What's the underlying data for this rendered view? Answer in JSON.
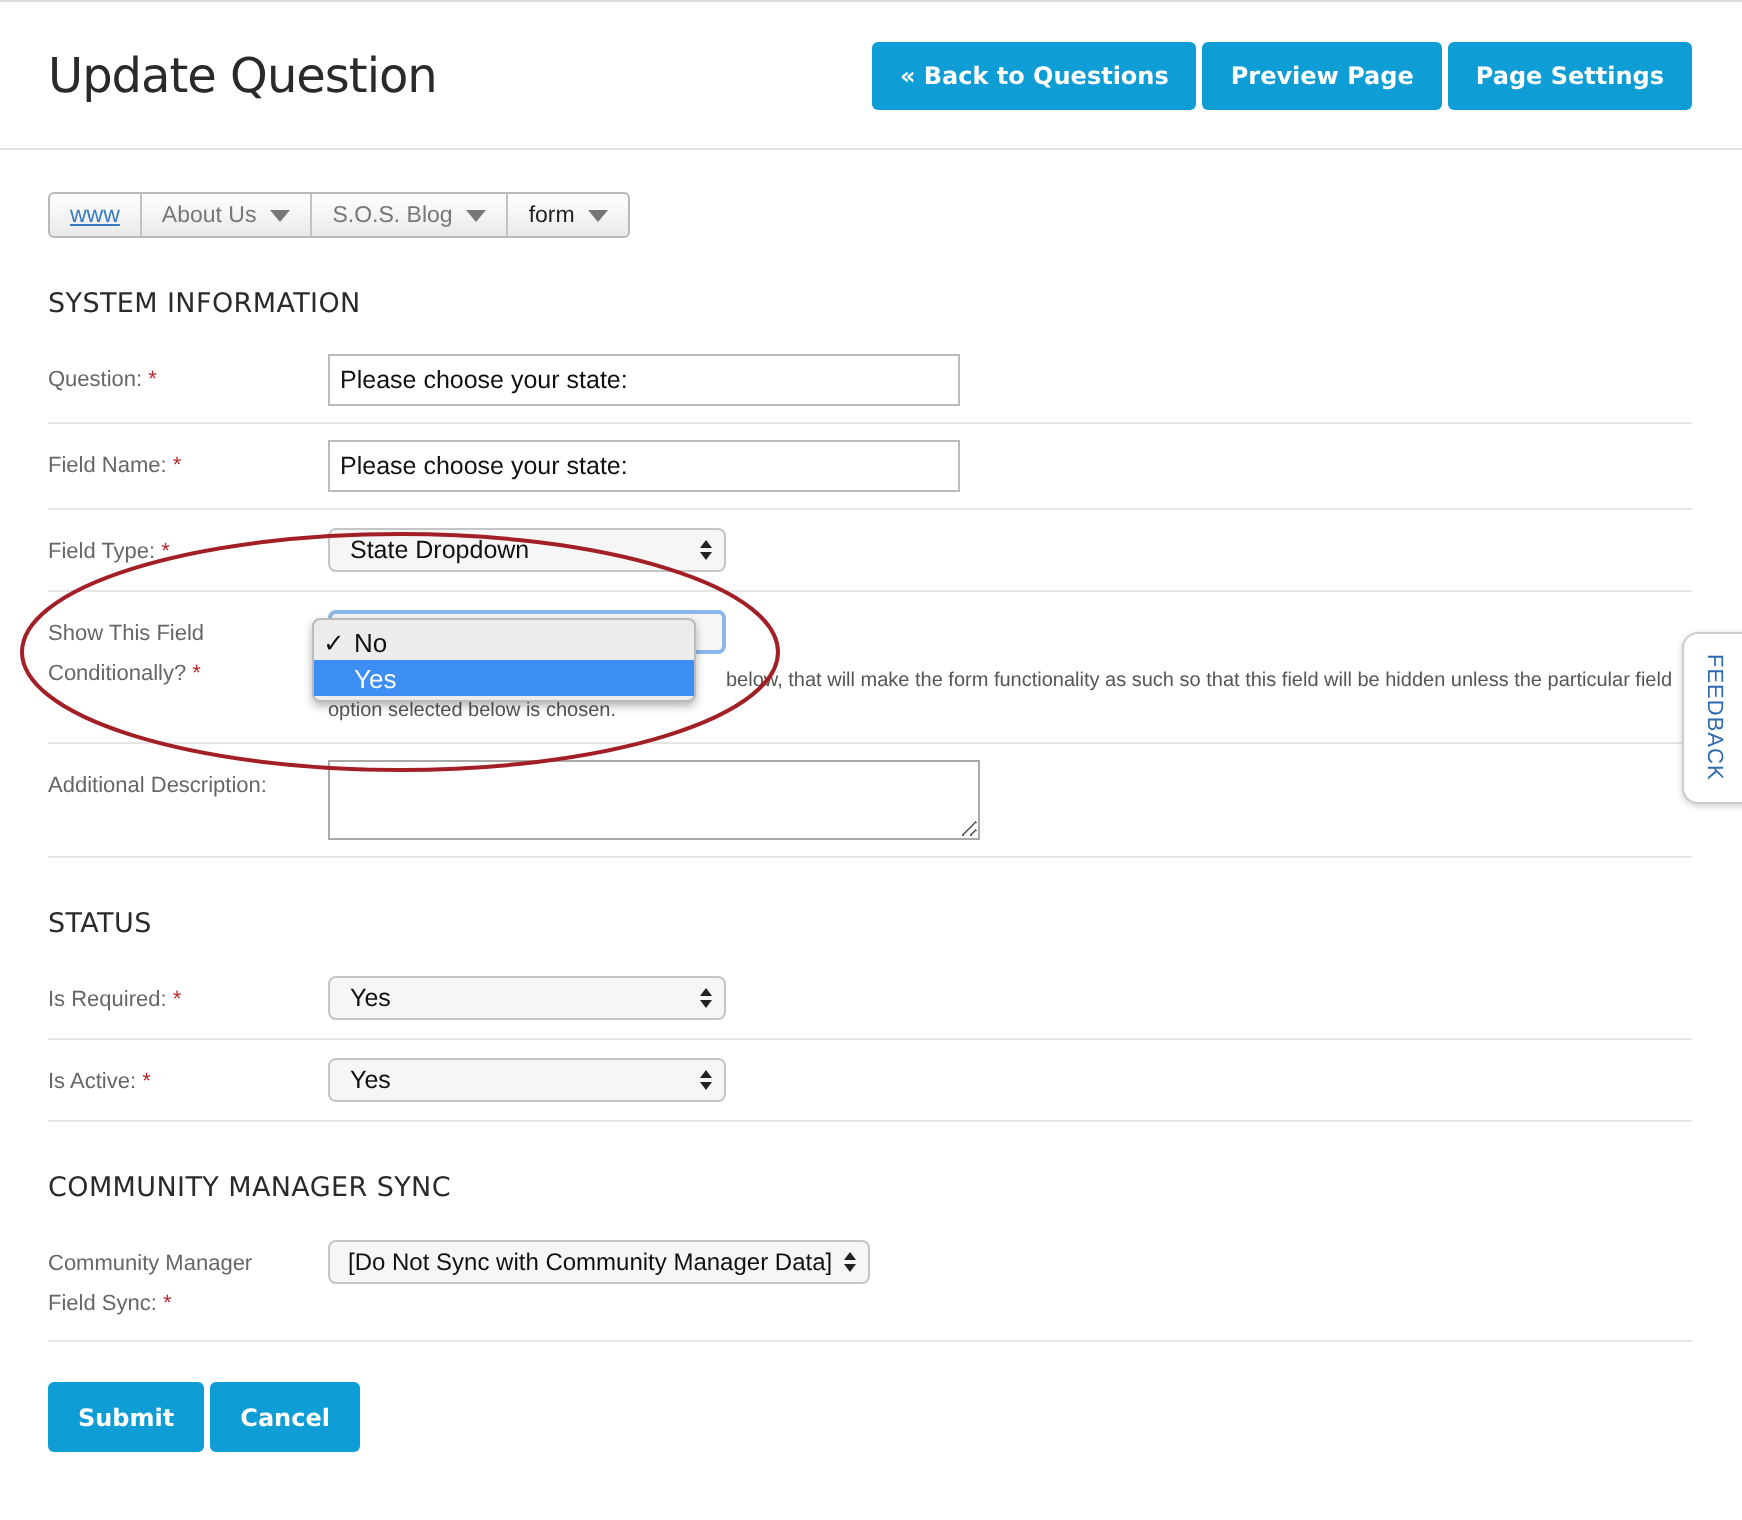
{
  "page": {
    "title": "Update Question"
  },
  "header_buttons": [
    "« Back to Questions",
    "Preview Page",
    "Page Settings"
  ],
  "breadcrumb": [
    {
      "label": "www",
      "kind": "link"
    },
    {
      "label": "About Us",
      "kind": "menu"
    },
    {
      "label": "S.O.S. Blog",
      "kind": "menu"
    },
    {
      "label": "form",
      "kind": "current"
    }
  ],
  "sections": [
    {
      "heading": "SYSTEM INFORMATION",
      "fields": [
        {
          "label": "Question:",
          "required_mark": "*",
          "kind": "text",
          "value": "Please choose your state:"
        },
        {
          "label": "Field Name:",
          "required_mark": "*",
          "kind": "text",
          "value": "Please choose your state:"
        },
        {
          "label": "Field Type:",
          "required_mark": "*",
          "kind": "select",
          "value": "State Dropdown"
        },
        {
          "label": "Show This Field Conditionally?",
          "required_mark": "*",
          "kind": "open-select",
          "help_lines": [
            "below, that will make the form functionality as such so that this field will be hidden unless the particular field",
            "option selected below is chosen."
          ],
          "check_mark": "✓",
          "options": [
            {
              "label": "No",
              "checked": true,
              "highlighted": false
            },
            {
              "label": "Yes",
              "checked": false,
              "highlighted": true
            }
          ]
        },
        {
          "label": "Additional Description:",
          "kind": "textarea"
        }
      ]
    },
    {
      "heading": "STATUS",
      "fields": [
        {
          "label": "Is Required:",
          "required_mark": "*",
          "kind": "select",
          "value": "Yes"
        },
        {
          "label": "Is Active:",
          "required_mark": "*",
          "kind": "select",
          "value": "Yes"
        }
      ]
    },
    {
      "heading": "COMMUNITY MANAGER SYNC",
      "fields": [
        {
          "label": "Community Manager Field Sync:",
          "required_mark": "*",
          "kind": "select",
          "wide": true,
          "value": "[Do Not Sync with Community Manager Data]"
        }
      ]
    }
  ],
  "form_buttons": [
    "Submit",
    "Cancel"
  ],
  "feedback_tab": "FEEDBACK",
  "annotation": {
    "kind": "ellipse"
  }
}
